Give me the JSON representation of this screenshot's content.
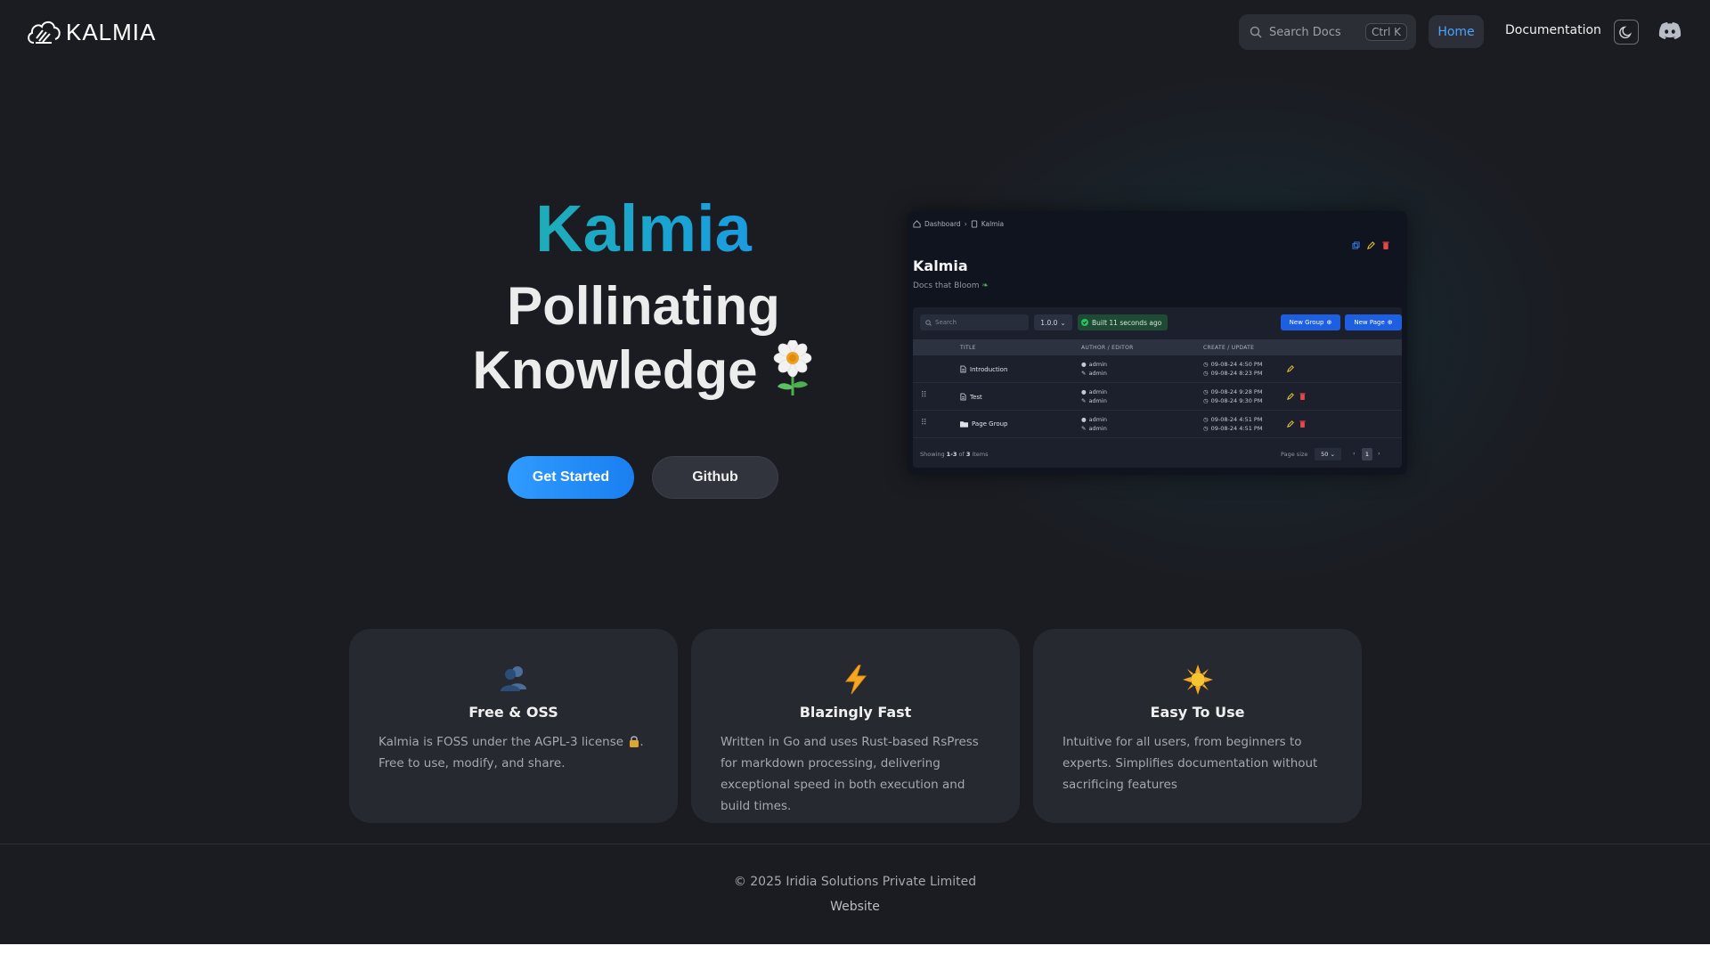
{
  "nav": {
    "logo_text": "KALMIA",
    "search_placeholder": "Search Docs",
    "search_shortcut": "Ctrl K",
    "links": [
      {
        "label": "Home",
        "active": true
      },
      {
        "label": "Documentation",
        "active": false
      }
    ],
    "theme_icon": "moon-icon",
    "community_icon": "discord-icon"
  },
  "hero": {
    "title": "Kalmia",
    "subtitle_line1": "Pollinating",
    "subtitle_line2": "Knowledge",
    "subtitle_icon": "flower-icon",
    "primary_button": "Get Started",
    "secondary_button": "Github"
  },
  "preview": {
    "breadcrumb": [
      "Dashboard",
      "Kalmia"
    ],
    "title": "Kalmia",
    "description": "Docs that Bloom",
    "description_icon": "leaf-icon",
    "search_placeholder": "Search",
    "version": "1.0.0",
    "build_status": "Built 11 seconds ago",
    "new_group_button": "New Group",
    "new_page_button": "New Page",
    "columns": [
      "TITLE",
      "AUTHOR / EDITOR",
      "CREATE / UPDATE"
    ],
    "rows": [
      {
        "title": "Introduction",
        "type": "page",
        "author": "admin",
        "editor": "admin",
        "created": "09-08-24 4:50 PM",
        "updated": "09-08-24 8:23 PM",
        "deletable": false
      },
      {
        "title": "Test",
        "type": "page",
        "author": "admin",
        "editor": "admin",
        "created": "09-08-24 9:28 PM",
        "updated": "09-08-24 9:30 PM",
        "deletable": true
      },
      {
        "title": "Page Group",
        "type": "folder",
        "author": "admin",
        "editor": "admin",
        "created": "09-08-24 4:51 PM",
        "updated": "09-08-24 4:51 PM",
        "deletable": true
      }
    ],
    "footer_showing": "Showing",
    "footer_range": "1-3",
    "footer_of": "of",
    "footer_total": "3",
    "footer_items": "items",
    "page_size_label": "Page size",
    "page_size": "50",
    "current_page": "1"
  },
  "features": [
    {
      "icon": "users-icon",
      "title": "Free & OSS",
      "text": "Kalmia is FOSS under the AGPL-3 license",
      "text_suffix": ". Free to use, modify, and share."
    },
    {
      "icon": "lightning-icon",
      "title": "Blazingly Fast",
      "text": "Written in Go and uses Rust-based RsPress for markdown processing, delivering exceptional speed in both execution and build times.",
      "text_suffix": ""
    },
    {
      "icon": "sun-icon",
      "title": "Easy To Use",
      "text": "Intuitive for all users, from beginners to experts. Simplifies documentation without sacrificing features",
      "text_suffix": ""
    }
  ],
  "footer": {
    "copyright": "© 2025 Iridia Solutions Private Limited",
    "link": "Website"
  },
  "colors": {
    "background": "#1b1c22",
    "accent_blue": "#2f9bff",
    "accent_teal": "#21b3a3",
    "card": "#262930"
  }
}
